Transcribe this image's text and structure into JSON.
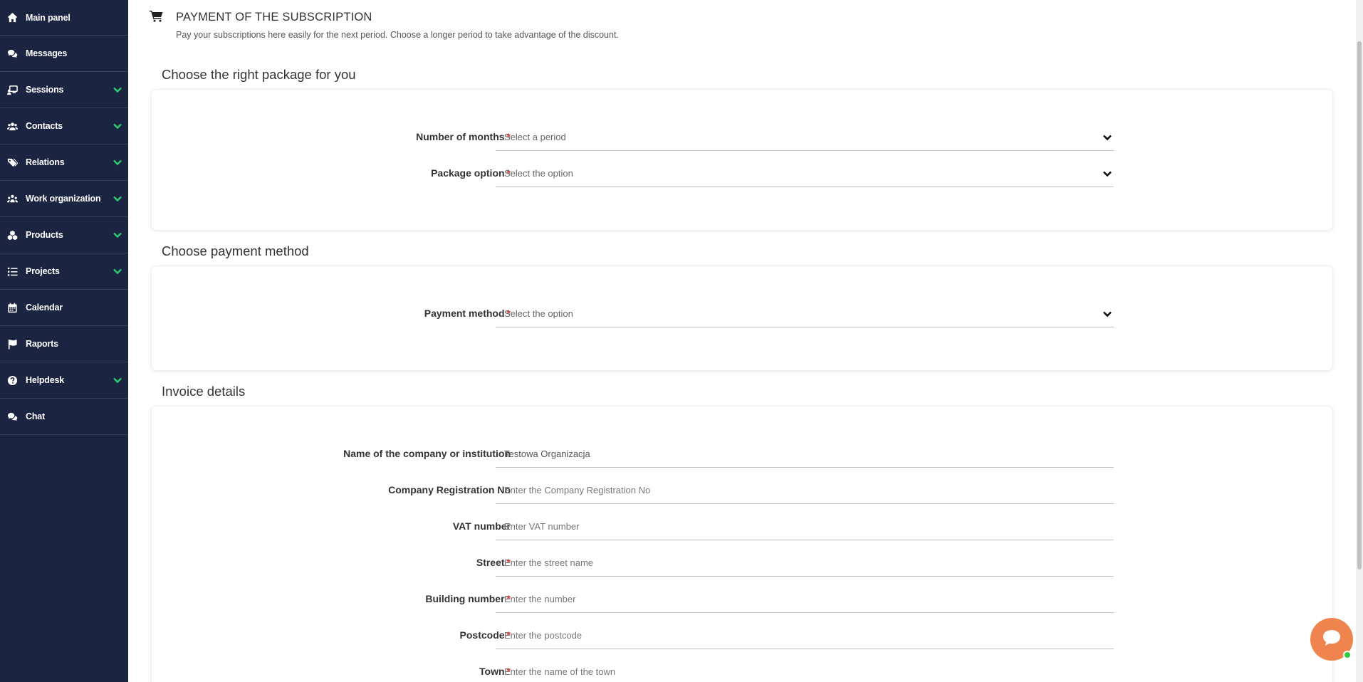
{
  "sidebar": {
    "items": [
      {
        "label": "Main panel",
        "icon": "home-icon",
        "expandable": false
      },
      {
        "label": "Messages",
        "icon": "comments-icon",
        "expandable": false
      },
      {
        "label": "Sessions",
        "icon": "chalkboard-user-icon",
        "expandable": true
      },
      {
        "label": "Contacts",
        "icon": "users-icon",
        "expandable": true
      },
      {
        "label": "Relations",
        "icon": "tags-icon",
        "expandable": true
      },
      {
        "label": "Work organization",
        "icon": "people-group-icon",
        "expandable": true
      },
      {
        "label": "Products",
        "icon": "cubes-icon",
        "expandable": true
      },
      {
        "label": "Projects",
        "icon": "list-check-icon",
        "expandable": true
      },
      {
        "label": "Calendar",
        "icon": "calendar-icon",
        "expandable": false
      },
      {
        "label": "Raports",
        "icon": "flag-icon",
        "expandable": false
      },
      {
        "label": "Helpdesk",
        "icon": "question-circle-icon",
        "expandable": true
      },
      {
        "label": "Chat",
        "icon": "comments-icon",
        "expandable": false
      }
    ]
  },
  "header": {
    "title": "PAYMENT OF THE SUBSCRIPTION",
    "subtitle": "Pay your subscriptions here easily for the next period. Choose a longer period to take advantage of the discount."
  },
  "package_section": {
    "title": "Choose the right package for you",
    "months_label": "Number of months",
    "months_value": "Select a period",
    "option_label": "Package option",
    "option_value": "Select the option"
  },
  "payment_section": {
    "title": "Choose payment method",
    "method_label": "Payment method",
    "method_value": "Select the option"
  },
  "invoice_section": {
    "title": "Invoice details",
    "company_label": "Name of the company or institution",
    "company_value": "Testowa Organizacja",
    "regno_label": "Company Registration No",
    "regno_placeholder": "Enter the Company Registration No",
    "vat_label": "VAT number",
    "vat_placeholder": "Enter VAT number",
    "street_label": "Street",
    "street_placeholder": "Enter the street name",
    "building_label": "Building number",
    "building_placeholder": "Enter the number",
    "postcode_label": "Postcode",
    "postcode_placeholder": "Enter the postcode",
    "town_label": "Town",
    "town_placeholder": "Enter the name of the town"
  },
  "required_mark": "*",
  "colors": {
    "sidebar_bg": "#1b2440",
    "chevron_green": "#2ecc71",
    "required_red": "#e53935",
    "chat_orange": "#f0844e"
  }
}
